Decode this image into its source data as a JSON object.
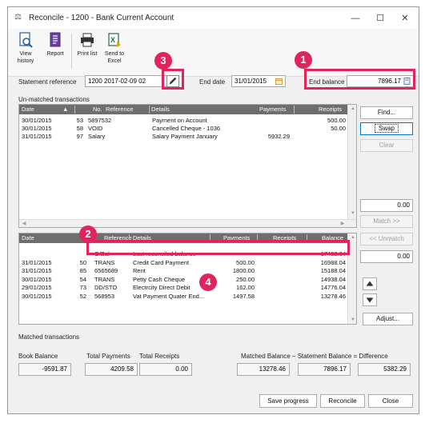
{
  "window": {
    "title": "Reconcile - 1200 - Bank Current Account",
    "controls": {
      "minimize": "—",
      "maximize": "☐",
      "close": "✕"
    }
  },
  "toolbar": {
    "view_history": "View history",
    "report": "Report",
    "print_list": "Print list",
    "send_to_excel": "Send to Excel"
  },
  "statement": {
    "reference_label": "Statement reference",
    "reference_value": "1200 2017-02-09 02",
    "end_date_label": "End date",
    "end_date_value": "31/01/2015",
    "end_balance_label": "End balance",
    "end_balance_value": "7896.17"
  },
  "unmatched": {
    "section_label": "Un-matched transactions",
    "columns": [
      "Date",
      "No.",
      "Reference",
      "Details",
      "Payments",
      "Receipts"
    ],
    "rows": [
      {
        "date": "30/01/2015",
        "no": "53",
        "ref": "5897532",
        "details": "Payment on Account",
        "payments": "",
        "receipts": "500.00"
      },
      {
        "date": "30/01/2015",
        "no": "58",
        "ref": "VOID",
        "details": "Cancelled Cheque - 1036",
        "payments": "",
        "receipts": "50.00"
      },
      {
        "date": "31/01/2015",
        "no": "97",
        "ref": "Salary",
        "details": "Salary Payment January",
        "payments": "5932.29",
        "receipts": ""
      }
    ]
  },
  "matched": {
    "section_label": "Matched transactions",
    "columns": [
      "Date",
      "",
      "Reference",
      "Details",
      "Payments",
      "Receipts",
      "Balance"
    ],
    "rows": [
      {
        "date": "",
        "no": "",
        "ref": "O/Bal",
        "details": "Last reconciled balance",
        "payments": "",
        "receipts": "",
        "balance": "17488.04"
      },
      {
        "date": "31/01/2015",
        "no": "50",
        "ref": "TRANS",
        "details": "Credit Card Payment",
        "payments": "500.00",
        "receipts": "",
        "balance": "16988.04"
      },
      {
        "date": "31/01/2015",
        "no": "85",
        "ref": "6565689",
        "details": "Rent",
        "payments": "1800.00",
        "receipts": "",
        "balance": "15188.04"
      },
      {
        "date": "30/01/2015",
        "no": "54",
        "ref": "TRANS",
        "details": "Petty Cash Cheque",
        "payments": "250.00",
        "receipts": "",
        "balance": "14938.04"
      },
      {
        "date": "29/01/2015",
        "no": "73",
        "ref": "DD/STO",
        "details": "Electrcity Direct Debit",
        "payments": "162.00",
        "receipts": "",
        "balance": "14776.04"
      },
      {
        "date": "30/01/2015",
        "no": "52",
        "ref": "568953",
        "details": "Vat Payment Quater End...",
        "payments": "1497.58",
        "receipts": "",
        "balance": "13278.46"
      }
    ]
  },
  "side_buttons": {
    "find": "Find...",
    "swap": "Swap",
    "clear": "Clear",
    "unmatched_total": "0.00",
    "match": "Match >>",
    "unmatch": "<< Unmatch",
    "matched_total": "0.00",
    "adjust": "Adjust..."
  },
  "totals": {
    "book_balance_label": "Book Balance",
    "book_balance": "-9591.87",
    "total_payments_label": "Total Payments",
    "total_payments": "4209.58",
    "total_receipts_label": "Total Receipts",
    "total_receipts": "0.00",
    "equation_label": "Matched Balance – Statement Balance = Difference",
    "matched_balance": "13278.46",
    "statement_balance": "7896.17",
    "difference": "5382.29"
  },
  "footer": {
    "save_progress": "Save progress",
    "reconcile": "Reconcile",
    "close": "Close"
  },
  "callouts": [
    "1",
    "2",
    "3",
    "4"
  ],
  "colors": {
    "accent": "#e0245e",
    "header": "#6e6e6e"
  }
}
